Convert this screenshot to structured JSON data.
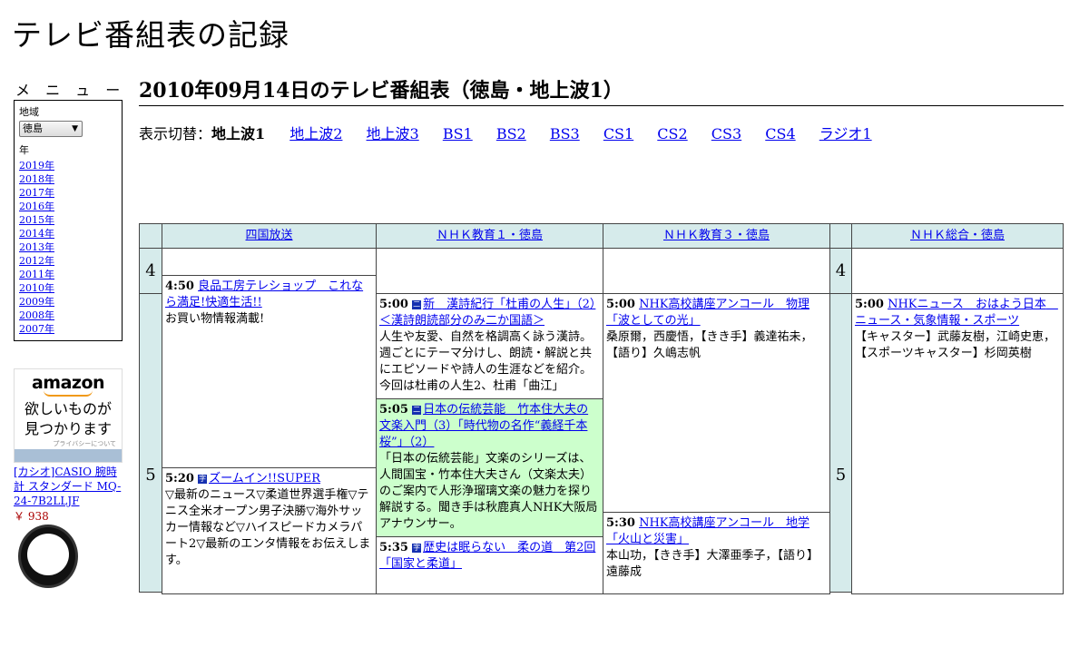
{
  "site": {
    "title": "テレビ番組表の記録"
  },
  "sidebar": {
    "menu_heading": "メ ニ ュ ー",
    "region_label": "地域",
    "region_value": "徳島",
    "year_label": "年",
    "years": [
      "2019年",
      "2018年",
      "2017年",
      "2016年",
      "2015年",
      "2014年",
      "2013年",
      "2012年",
      "2011年",
      "2010年",
      "2009年",
      "2008年",
      "2007年"
    ]
  },
  "ad": {
    "logo": "amazon",
    "tagline_line1": "欲しいものが",
    "tagline_line2": "見つかります",
    "privacy": "プライバシーについて",
    "product_title": "[カシオ]CASIO 腕時計 スタンダード MQ-24-7B2LLJF",
    "product_price": "￥ 938"
  },
  "main": {
    "title": "2010年09月14日のテレビ番組表（徳島・地上波1）",
    "switcher_label": "表示切替：",
    "switcher_current": "地上波1",
    "switcher_links": [
      "地上波2",
      "地上波3",
      "BS1",
      "BS2",
      "BS3",
      "CS1",
      "CS2",
      "CS3",
      "CS4",
      "ラジオ1"
    ]
  },
  "schedule": {
    "channels": [
      "四国放送",
      "ＮＨＫ教育１・徳島",
      "ＮＨＫ教育３・徳島",
      "ＮＨＫ総合・徳島"
    ],
    "hours": [
      "4",
      "5"
    ],
    "programs": {
      "shikoku_0450": {
        "time": "4:50",
        "title": "良品工房テレショップ　これなら満足!快適生活!!",
        "desc": "お買い物情報満載!"
      },
      "shikoku_0520": {
        "time": "5:20",
        "icon": "字",
        "title": "ズームイン!!SUPER",
        "desc": "▽最新のニュース▽柔道世界選手権▽テニス全米オープン男子決勝▽海外サッカー情報など▽ハイスピードカメラパート2▽最新のエンタ情報をお伝えします。"
      },
      "edu1_0500": {
        "time": "5:00",
        "icon": "二",
        "title": "新　漢詩紀行「杜甫の人生」（2）＜漢詩朗読部分のみ二か国語＞",
        "desc": "人生や友愛、自然を格調高く詠う漢詩。週ごとにテーマ分けし、朗読・解説と共にエピソードや詩人の生涯などを紹介。今回は杜甫の人生2、杜甫「曲江」"
      },
      "edu1_0505": {
        "time": "5:05",
        "icon": "二",
        "title": "日本の伝統芸能　竹本住大夫の文楽入門（3）「時代物の名作“義経千本桜”」（2）",
        "desc": "「日本の伝統芸能」文楽のシリーズは、人間国宝・竹本住大夫さん（文楽太夫）のご案内で人形浄瑠璃文楽の魅力を探り解説する。聞き手は秋鹿真人NHK大阪局アナウンサー。"
      },
      "edu1_0535": {
        "time": "5:35",
        "icon": "字",
        "title": "歴史は眠らない　柔の道　第2回「国家と柔道」",
        "desc": ""
      },
      "edu3_0500": {
        "time": "5:00",
        "title": "NHK高校講座アンコール　物理「波としての光」",
        "desc": "桑原爾，西慶悟，【きき手】義達祐未，【語り】久嶋志帆"
      },
      "edu3_0530": {
        "time": "5:30",
        "title": "NHK高校講座アンコール　地学「火山と災害」",
        "desc": "本山功，【きき手】大澤亜季子，【語り】遠藤成"
      },
      "sogo_0500": {
        "time": "5:00",
        "title": "NHKニュース　おはよう日本　ニュース・気象情報・スポーツ",
        "desc": "【キャスター】武藤友樹，江崎史恵，【スポーツキャスター】杉岡英樹"
      }
    }
  }
}
